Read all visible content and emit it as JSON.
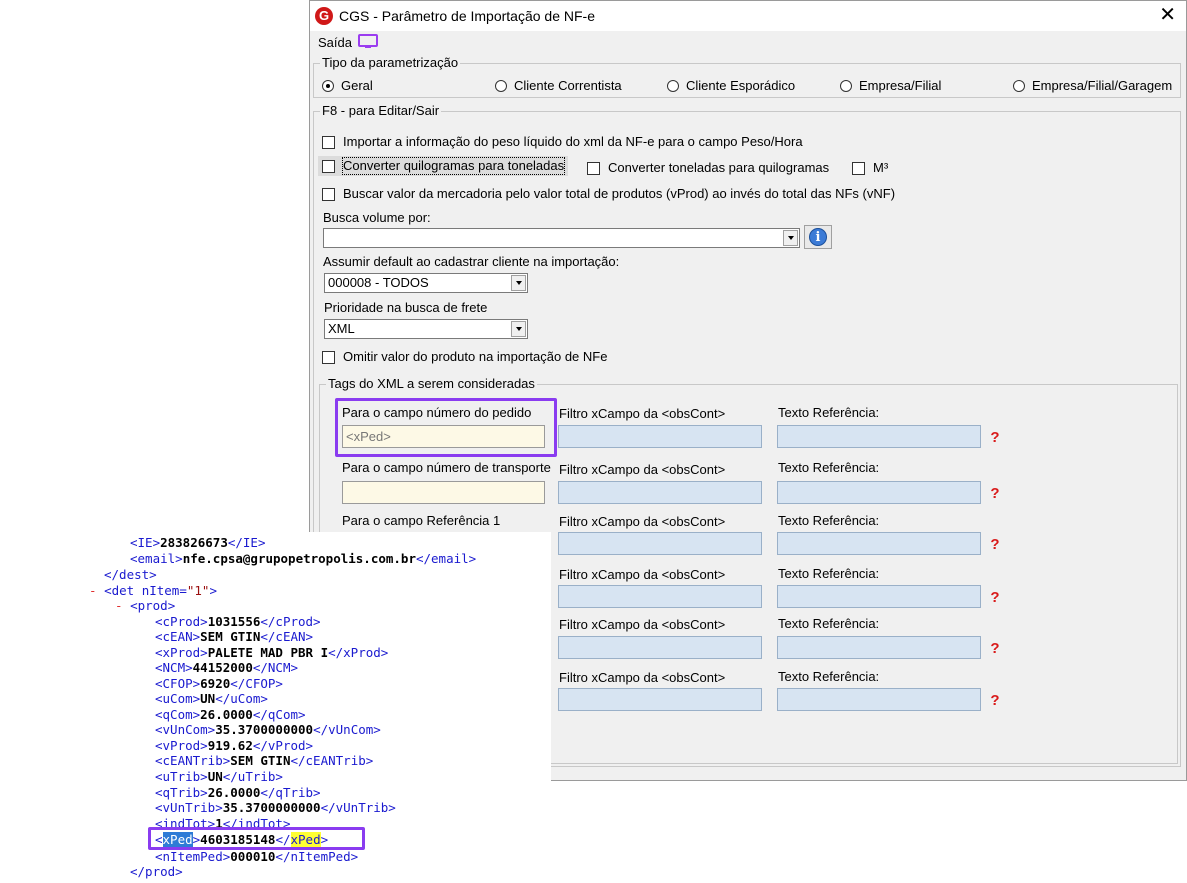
{
  "window": {
    "logo_letter": "G",
    "title": "CGS - Parâmetro de Importação de NF-e",
    "close_glyph": "✕",
    "menu": {
      "saida": "Saída"
    }
  },
  "tipo": {
    "legend": "Tipo da parametrização",
    "options": [
      {
        "label": "Geral",
        "selected": true
      },
      {
        "label": "Cliente Correntista",
        "selected": false
      },
      {
        "label": "Cliente Esporádico",
        "selected": false
      },
      {
        "label": "Empresa/Filial",
        "selected": false
      },
      {
        "label": "Empresa/Filial/Garagem",
        "selected": false
      }
    ]
  },
  "editar": {
    "legend": "F8 - para Editar/Sair",
    "chk_peso": "Importar a informação do peso líquido do xml da NF-e para o campo Peso/Hora",
    "chk_kg_ton": "Converter quilogramas para toneladas",
    "chk_ton_kg": "Converter toneladas para quilogramas",
    "chk_m3": "M³",
    "chk_vprod": "Buscar valor da mercadoria pelo valor total de produtos (vProd) ao invés do total das NFs (vNF)",
    "busca_volume_label": "Busca volume por:",
    "busca_volume_value": "",
    "info_glyph": "i",
    "assumir_label": "Assumir default ao cadastrar cliente na importação:",
    "assumir_value": "000008 - TODOS",
    "prioridade_label": "Prioridade na busca de frete",
    "prioridade_value": "XML",
    "chk_omitir": "Omitir valor do produto na importação de NFe"
  },
  "tags": {
    "legend": "Tags do XML a serem consideradas",
    "qmark": "?",
    "rows": [
      {
        "campo_label": "Para o campo número do pedido",
        "campo_value": "<xPed>",
        "filtro_label": "Filtro xCampo da <obsCont>",
        "texto_label": "Texto Referência:"
      },
      {
        "campo_label": "Para o campo número de transporte",
        "campo_value": "",
        "filtro_label": "Filtro xCampo da <obsCont>",
        "texto_label": "Texto Referência:"
      },
      {
        "campo_label": "Para o campo Referência 1",
        "campo_value": "",
        "filtro_label": "Filtro xCampo da <obsCont>",
        "texto_label": "Texto Referência:"
      },
      {
        "filtro_label": "Filtro xCampo da <obsCont>",
        "texto_label": "Texto Referência:"
      },
      {
        "filtro_label": "Filtro xCampo da <obsCont>",
        "texto_label": "Texto Referência:"
      },
      {
        "filtro_label": "Filtro xCampo da <obsCont>",
        "texto_label": "Texto Referência:"
      }
    ]
  },
  "xml": {
    "ie": {
      "open": "<IE>",
      "value": "283826673",
      "close": "</IE>"
    },
    "email": {
      "open": "<email>",
      "value": "nfe.cpsa@grupopetropolis.com.br",
      "close": "</email>"
    },
    "dest_close": "</dest>",
    "minus": "-",
    "det_open": "<det nItem=",
    "det_attr": "\"1\"",
    "det_end": ">",
    "prod_open": "<prod>",
    "items": [
      {
        "open": "<cProd>",
        "value": "1031556",
        "close": "</cProd>"
      },
      {
        "open": "<cEAN>",
        "value": "SEM GTIN",
        "close": "</cEAN>"
      },
      {
        "open": "<xProd>",
        "value": "PALETE MAD PBR I",
        "close": "</xProd>"
      },
      {
        "open": "<NCM>",
        "value": "44152000",
        "close": "</NCM>"
      },
      {
        "open": "<CFOP>",
        "value": "6920",
        "close": "</CFOP>"
      },
      {
        "open": "<uCom>",
        "value": "UN",
        "close": "</uCom>"
      },
      {
        "open": "<qCom>",
        "value": "26.0000",
        "close": "</qCom>"
      },
      {
        "open": "<vUnCom>",
        "value": "35.3700000000",
        "close": "</vUnCom>"
      },
      {
        "open": "<vProd>",
        "value": "919.62",
        "close": "</vProd>"
      },
      {
        "open": "<cEANTrib>",
        "value": "SEM GTIN",
        "close": "</cEANTrib>"
      },
      {
        "open": "<uTrib>",
        "value": "UN",
        "close": "</uTrib>"
      },
      {
        "open": "<qTrib>",
        "value": "26.0000",
        "close": "</qTrib>"
      },
      {
        "open": "<vUnTrib>",
        "value": "35.3700000000",
        "close": "</vUnTrib>"
      },
      {
        "open": "<indTot>",
        "value": "1",
        "close": "</indTot>"
      }
    ],
    "xped": {
      "lt": "<",
      "name": "xPed",
      "gt": ">",
      "value": "4603185148",
      "close_lt": "</",
      "close_gt": ">"
    },
    "nitemped": {
      "open": "<nItemPed>",
      "value": "000010",
      "close": "</nItemPed>"
    },
    "prod_close": "</prod>"
  }
}
